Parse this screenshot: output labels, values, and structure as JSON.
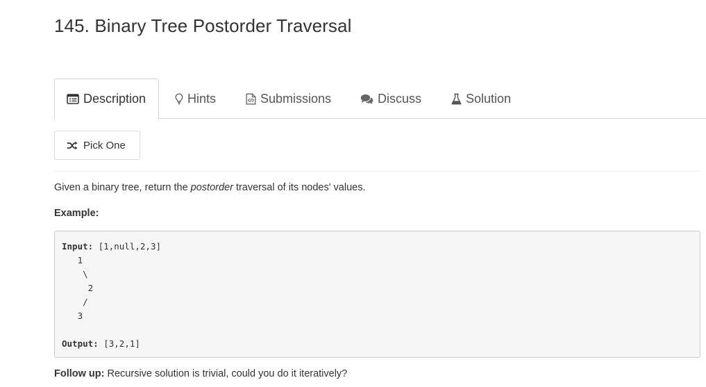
{
  "problem": {
    "title": "145. Binary Tree Postorder Traversal"
  },
  "tabs": [
    {
      "label": "Description",
      "icon": "description-icon",
      "active": true
    },
    {
      "label": "Hints",
      "icon": "lightbulb-icon",
      "active": false
    },
    {
      "label": "Submissions",
      "icon": "code-file-icon",
      "active": false
    },
    {
      "label": "Discuss",
      "icon": "comments-icon",
      "active": false
    },
    {
      "label": "Solution",
      "icon": "flask-icon",
      "active": false
    }
  ],
  "pick_one": {
    "label": "Pick One",
    "icon": "shuffle-icon"
  },
  "description": {
    "before": "Given a binary tree, return the ",
    "emphasis": "postorder",
    "after": " traversal of its nodes' values."
  },
  "example": {
    "label": "Example:",
    "input_label": "Input:",
    "input_value": " [1,null,2,3]",
    "tree_lines": [
      "   1",
      "    \\",
      "     2",
      "    /",
      "   3"
    ],
    "output_label": "Output:",
    "output_value": " [3,2,1]"
  },
  "follow_up": {
    "label": "Follow up:",
    "text": " Recursive solution is trivial, could you do it iteratively?"
  },
  "colors": {
    "text": "#333333",
    "tab_text": "#555555",
    "border": "#d7d7d7",
    "code_bg": "#f5f5f5"
  }
}
